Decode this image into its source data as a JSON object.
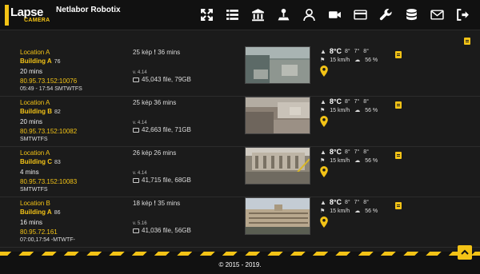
{
  "header": {
    "logo_text": "Lapse",
    "logo_sub": "CAMERA",
    "app_title": "Netlabor Robotix",
    "nav_icons": [
      "fullscreen-icon",
      "list-icon",
      "bank-icon",
      "joystick-icon",
      "user-icon",
      "video-icon",
      "card-icon",
      "wrench-icon",
      "database-icon",
      "mail-icon",
      "logout-icon"
    ]
  },
  "cameras": [
    {
      "location": "Location A",
      "building": "Building A",
      "id": "76",
      "interval": "20 mins",
      "ip": "80.95.73.152:10076",
      "schedule": "05:49 - 17:54 SMTWTFS",
      "count": "25 kép ",
      "warn": "!",
      "since": " 36 mins",
      "version": "v. 4.14",
      "files": "45,043 file, 79GB",
      "temp": "8°C",
      "temps_small": "8°  7°  8°",
      "wind": "15 km/h",
      "humidity": "56 %"
    },
    {
      "location": "Location A",
      "building": "Building B",
      "id": "82",
      "interval": "20 mins",
      "ip": "80.95.73.152:10082",
      "schedule": "SMTWTFS",
      "count": "25 kép 36 mins",
      "warn": "",
      "since": "",
      "version": "v. 4.14",
      "files": "42,663 file, 71GB",
      "temp": "8°C",
      "temps_small": "8°  7°  8°",
      "wind": "15 km/h",
      "humidity": "56 %"
    },
    {
      "location": "Location A",
      "building": "Building C",
      "id": "83",
      "interval": "4 mins",
      "ip": "80.95.73.152:10083",
      "schedule": "SMTWTFS",
      "count": "26 kép 26 mins",
      "warn": "",
      "since": "",
      "version": "v. 4.14",
      "files": "41,715 file, 68GB",
      "temp": "8°C",
      "temps_small": "8°  7°  8°",
      "wind": "15 km/h",
      "humidity": "56 %"
    },
    {
      "location": "Location B",
      "building": "Building A",
      "id": "86",
      "interval": "16 mins",
      "ip": "80.95.72.161",
      "schedule": "07:00,17:54 -MTWTF-",
      "count": "18 kép ",
      "warn": "!",
      "since": " 35 mins",
      "version": "v. 5.16",
      "files": "41,036 file, 56GB",
      "temp": "8°C",
      "temps_small": "8°  7°  8°",
      "wind": "15 km/h",
      "humidity": "56 %"
    }
  ],
  "footer": {
    "copyright": "© 2015 - 2019."
  },
  "colors": {
    "accent": "#f3c316",
    "background": "#1b1b1b"
  }
}
